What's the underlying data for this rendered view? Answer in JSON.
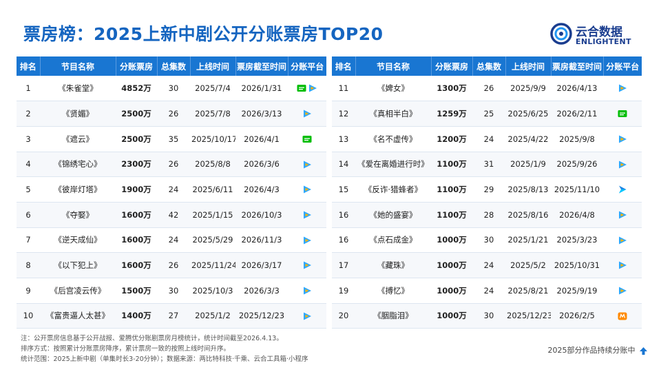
{
  "title": "票房榜：2025上新中剧公开分账票房TOP20",
  "logo": {
    "cn": "云合数据",
    "en": "ENLIGHTENT"
  },
  "colors": {
    "header_bg": "#1976d2",
    "title": "#1565c0",
    "iqiyi": "#00be06",
    "tencent": "#2ea8ff",
    "mango": "#ff8a00"
  },
  "chart_data": {
    "type": "table",
    "columns": [
      "排名",
      "节目名称",
      "分账票房",
      "总集数",
      "上线时间",
      "票房截至时间",
      "分账平台"
    ],
    "left_rows": [
      {
        "rank": "1",
        "name": "《朱雀堂》",
        "box": "4852万",
        "eps": "30",
        "start": "2025/7/4",
        "end": "2026/1/31",
        "platforms": [
          "iqiyi",
          "tencent"
        ]
      },
      {
        "rank": "2",
        "name": "《贤媚》",
        "box": "2500万",
        "eps": "26",
        "start": "2025/7/8",
        "end": "2026/3/13",
        "platforms": [
          "tencent"
        ]
      },
      {
        "rank": "3",
        "name": "《遮云》",
        "box": "2500万",
        "eps": "35",
        "start": "2025/10/17",
        "end": "2026/4/1",
        "platforms": [
          "iqiyi"
        ]
      },
      {
        "rank": "4",
        "name": "《锦绣宅心》",
        "box": "2300万",
        "eps": "26",
        "start": "2025/8/8",
        "end": "2026/3/6",
        "platforms": [
          "tencent"
        ]
      },
      {
        "rank": "5",
        "name": "《彼岸灯塔》",
        "box": "1900万",
        "eps": "24",
        "start": "2025/6/11",
        "end": "2026/4/3",
        "platforms": [
          "tencent"
        ]
      },
      {
        "rank": "6",
        "name": "《夺娶》",
        "box": "1600万",
        "eps": "42",
        "start": "2025/1/15",
        "end": "2026/10/3",
        "platforms": [
          "tencent"
        ]
      },
      {
        "rank": "7",
        "name": "《逆天成仙》",
        "box": "1600万",
        "eps": "24",
        "start": "2025/5/29",
        "end": "2026/11/3",
        "platforms": [
          "tencent"
        ]
      },
      {
        "rank": "8",
        "name": "《以下犯上》",
        "box": "1600万",
        "eps": "26",
        "start": "2025/11/24",
        "end": "2026/3/17",
        "platforms": [
          "tencent"
        ]
      },
      {
        "rank": "9",
        "name": "《后宫凌云传》",
        "box": "1500万",
        "eps": "30",
        "start": "2025/10/3",
        "end": "2026/3/3",
        "platforms": [
          "tencent"
        ]
      },
      {
        "rank": "10",
        "name": "《富贵逼人太甚》",
        "box": "1400万",
        "eps": "27",
        "start": "2025/1/2",
        "end": "2025/12/23",
        "platforms": [
          "tencent"
        ]
      }
    ],
    "right_rows": [
      {
        "rank": "11",
        "name": "《婢女》",
        "box": "1300万",
        "eps": "26",
        "start": "2025/9/9",
        "end": "2026/4/13",
        "platforms": [
          "tencent"
        ]
      },
      {
        "rank": "12",
        "name": "《真相半白》",
        "box": "1259万",
        "eps": "25",
        "start": "2025/6/25",
        "end": "2026/2/11",
        "platforms": [
          "iqiyi"
        ]
      },
      {
        "rank": "13",
        "name": "《名不虚传》",
        "box": "1200万",
        "eps": "24",
        "start": "2025/4/22",
        "end": "2025/9/8",
        "platforms": [
          "tencent"
        ]
      },
      {
        "rank": "14",
        "name": "《爱在离婚进行时》",
        "box": "1100万",
        "eps": "31",
        "start": "2025/1/9",
        "end": "2025/9/26",
        "platforms": [
          "tencent"
        ]
      },
      {
        "rank": "15",
        "name": "《反诈·猎蜂者》",
        "box": "1100万",
        "eps": "29",
        "start": "2025/8/13",
        "end": "2025/11/10",
        "platforms": [
          "youku"
        ]
      },
      {
        "rank": "16",
        "name": "《她的盛宴》",
        "box": "1100万",
        "eps": "28",
        "start": "2025/8/16",
        "end": "2026/4/8",
        "platforms": [
          "tencent"
        ]
      },
      {
        "rank": "16",
        "name": "《点石成金》",
        "box": "1000万",
        "eps": "30",
        "start": "2025/1/21",
        "end": "2025/3/23",
        "platforms": [
          "tencent"
        ]
      },
      {
        "rank": "17",
        "name": "《藏珠》",
        "box": "1000万",
        "eps": "24",
        "start": "2025/5/2",
        "end": "2025/10/31",
        "platforms": [
          "tencent"
        ]
      },
      {
        "rank": "19",
        "name": "《搏忆》",
        "box": "1000万",
        "eps": "24",
        "start": "2025/8/21",
        "end": "2025/9/19",
        "platforms": [
          "tencent"
        ]
      },
      {
        "rank": "20",
        "name": "《胭脂泪》",
        "box": "1000万",
        "eps": "30",
        "start": "2025/12/23",
        "end": "2026/2/5",
        "platforms": [
          "mango"
        ]
      }
    ]
  },
  "notes": [
    "注：公开票房信息基于公开战报、爱腾优分账剧票房月榜统计，统计时间截至2026.4.13。",
    "排序方式：按照累计分账票房降序，累计票房一致的按照上线时间升序。",
    "统计范围：2025上新中剧（单集时长3-20分钟）；数据来源：两比特科技·千乘、云合工具箱·小程序"
  ],
  "footer": "2025部分作品持续分账中"
}
